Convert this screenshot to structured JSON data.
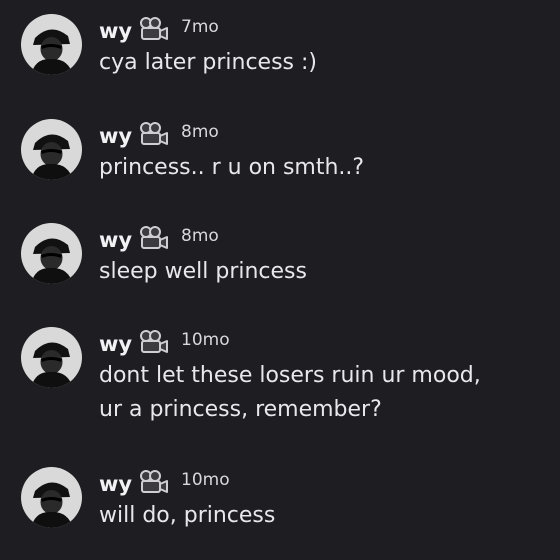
{
  "messages": [
    {
      "username": "wy",
      "icon": "camera-icon",
      "time": "7mo",
      "lines": [
        "cya later princess :)"
      ]
    },
    {
      "username": "wy",
      "icon": "camera-icon",
      "time": "8mo",
      "lines": [
        "princess.. r u on smth..?"
      ]
    },
    {
      "username": "wy",
      "icon": "camera-icon",
      "time": "8mo",
      "lines": [
        "sleep well princess"
      ]
    },
    {
      "username": "wy",
      "icon": "camera-icon",
      "time": "10mo",
      "lines": [
        "dont let these losers ruin ur mood,",
        "ur a princess, remember?"
      ]
    },
    {
      "username": "wy",
      "icon": "camera-icon",
      "time": "10mo",
      "lines": [
        "will do, princess"
      ]
    }
  ],
  "colors": {
    "background": "#1e1e22",
    "text": "#e8e8ec",
    "username": "#f2f2f5"
  }
}
